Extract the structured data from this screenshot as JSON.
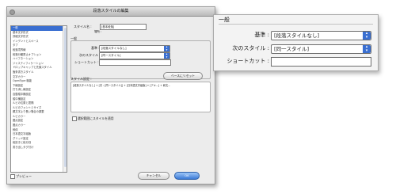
{
  "dialog": {
    "title": "段落スタイルの編集",
    "sidebar_items": [
      {
        "label": "一般",
        "selected": true
      },
      {
        "label": "基本文字形式",
        "selected": false
      },
      {
        "label": "詳細文字形式",
        "selected": false
      },
      {
        "label": "インデントとスペース",
        "selected": false
      },
      {
        "label": "タブ",
        "selected": false
      },
      {
        "label": "段落境界線",
        "selected": false
      },
      {
        "label": "段落分離禁止オプション",
        "selected": false
      },
      {
        "label": "ハイフネーション",
        "selected": false
      },
      {
        "label": "ジャスティフィケーション",
        "selected": false
      },
      {
        "label": "ドロップキャップと先頭スタイル",
        "selected": false
      },
      {
        "label": "箇条書きスタイル",
        "selected": false
      },
      {
        "label": "文字カラー",
        "selected": false
      },
      {
        "label": "OpenType 機能",
        "selected": false
      },
      {
        "label": "下線設定",
        "selected": false
      },
      {
        "label": "打ち消し線設定",
        "selected": false
      },
      {
        "label": "自動縦中横設定",
        "selected": false
      },
      {
        "label": "縦中横設定",
        "selected": false
      },
      {
        "label": "ルビの位置と間隔",
        "selected": false
      },
      {
        "label": "ルビのフォントとサイズ",
        "selected": false
      },
      {
        "label": "親文字より長い場合の調整",
        "selected": false
      },
      {
        "label": "ルビカラー",
        "selected": false
      },
      {
        "label": "圏点設定",
        "selected": false
      },
      {
        "label": "圏点カラー",
        "selected": false
      },
      {
        "label": "斜体",
        "selected": false
      },
      {
        "label": "日本語文字組版",
        "selected": false
      },
      {
        "label": "グリッド設定",
        "selected": false
      },
      {
        "label": "段抜きと段分割",
        "selected": false
      },
      {
        "label": "書き出しタグ付け",
        "selected": false
      }
    ],
    "style_name_label": "スタイル名 :",
    "style_name_value": "[基本段落]",
    "location_label": "場所 :",
    "section_general": "一般",
    "based_on_label": "基準 :",
    "based_on_value": "[段落スタイルなし]",
    "next_style_label": "次のスタイル :",
    "next_style_value": "[同一スタイル]",
    "shortcut_label": "ショートカット :",
    "shortcut_value": "",
    "reset_button": "ベースにリセット",
    "style_settings_label": "スタイル設定 :",
    "style_settings_text": "[段落スタイルなし] + [次 : [同一スタイル]] + [日本語文字組版] + [アキ...] + 和文...",
    "apply_checkbox_label": "選択範囲にスタイルを適用",
    "preview_label": "プレビュー",
    "cancel_button": "キャンセル",
    "ok_button": "OK"
  },
  "zoom": {
    "header": "一般",
    "based_on_label": "基準 :",
    "based_on_value": "[段落スタイルなし]",
    "next_style_label": "次のスタイル :",
    "next_style_value": "[同一スタイル]",
    "shortcut_label": "ショートカット :",
    "shortcut_value": ""
  },
  "colors": {
    "accent": "#3a6fd1",
    "panel": "#ececec"
  },
  "icons": {
    "select_arrow": "up-down-arrows-icon",
    "checkbox": "checkbox-icon"
  }
}
